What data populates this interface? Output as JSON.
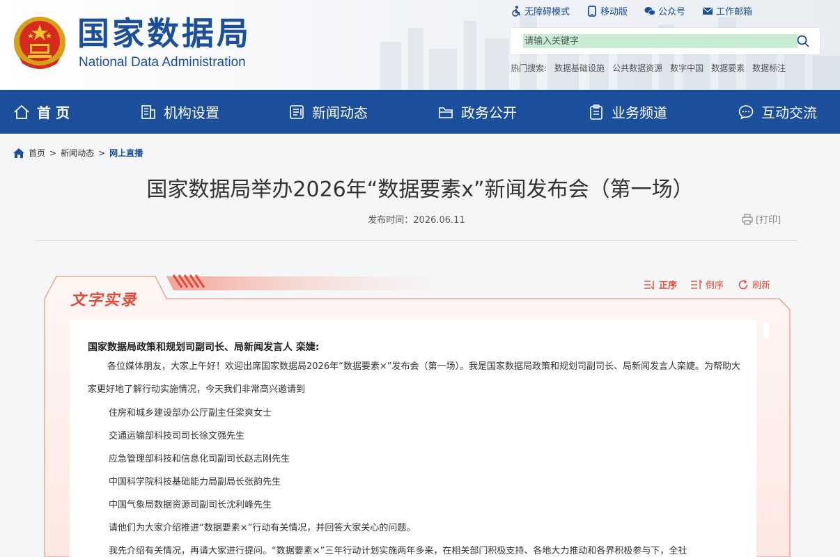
{
  "header": {
    "logo_cn": "国家数据局",
    "logo_en": "National Data Administration",
    "toplinks": [
      "无障碍模式",
      "移动版",
      "公众号",
      "工作邮箱"
    ],
    "search_placeholder": "请输入关键字",
    "hot_label": "热门搜索:",
    "hot_keywords": [
      "数据基础设施",
      "公共数据资源",
      "数字中国",
      "数据要素",
      "数据标注"
    ]
  },
  "nav": {
    "items": [
      "首 页",
      "机构设置",
      "新闻动态",
      "政务公开",
      "业务频道",
      "互动交流"
    ]
  },
  "breadcrumb": {
    "home": "首页",
    "sep": ">",
    "level1": "新闻动态",
    "current": "网上直播"
  },
  "article": {
    "title": "国家数据局举办2026年“数据要素x”新闻发布会（第一场）",
    "publish_label": "发布时间：2026.06.11",
    "print_label": "[打印]"
  },
  "transcript": {
    "tab_title": "文字实录",
    "controls": [
      "正序",
      "倒序",
      "刷新"
    ],
    "speaker": "国家数据局政策和规划司副司长、局新闻发言人 栾婕:",
    "para1": "各位媒体朋友，大家上午好！欢迎出席国家数据局2026年“数据要素×”发布会（第一场）。我是国家数据局政策和规划司副司长、局新闻发言人栾婕。为帮助大家更好地了解行动实施情况，今天我们非常高兴邀请到",
    "guests": [
      "住房和城乡建设部办公厅副主任梁爽女士",
      "交通运输部科技司司长徐文强先生",
      "应急管理部科技和信息化司副司长赵志刚先生",
      "中国科学院科技基础能力局副局长张韵先生",
      "中国气象局数据资源司副司长沈利峰先生",
      "请他们为大家介绍推进“数据要素×”行动有关情况，并回答大家关心的问题。",
      "我先介绍有关情况，再请大家进行提问。“数据要素×”三年行动计划实施两年多来，在相关部门积极支持、各地大力推动和各界积极参与下，全社"
    ]
  }
}
